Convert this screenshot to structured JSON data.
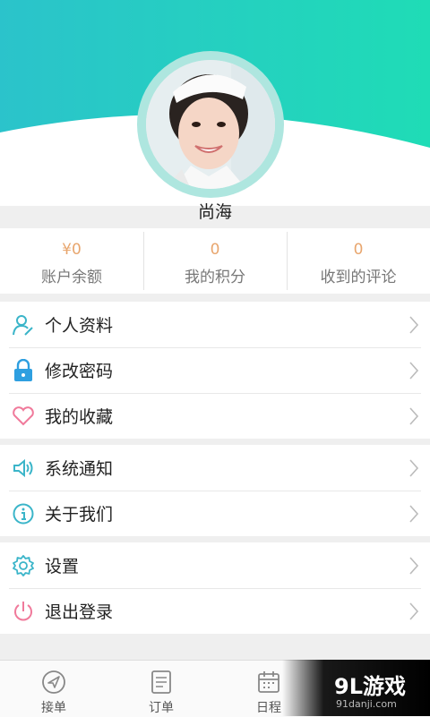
{
  "profile": {
    "name": "尚海"
  },
  "stats": [
    {
      "value": "¥0",
      "label": "账户余额"
    },
    {
      "value": "0",
      "label": "我的积分"
    },
    {
      "value": "0",
      "label": "收到的评论"
    }
  ],
  "menu": {
    "profile": "个人资料",
    "password": "修改密码",
    "favorites": "我的收藏",
    "notifications": "系统通知",
    "about": "关于我们",
    "settings": "设置",
    "logout": "退出登录"
  },
  "tabs": {
    "orders_take": "接单",
    "orders": "订单",
    "schedule": "日程"
  },
  "watermark": {
    "logo": "9L游戏",
    "url": "91danji.com"
  },
  "colors": {
    "header_start": "#27c9c8",
    "header_end": "#1edcb8",
    "accent_value": "#e8a66e",
    "icon_teal": "#3bb5c9",
    "icon_pink": "#f07a9b"
  }
}
